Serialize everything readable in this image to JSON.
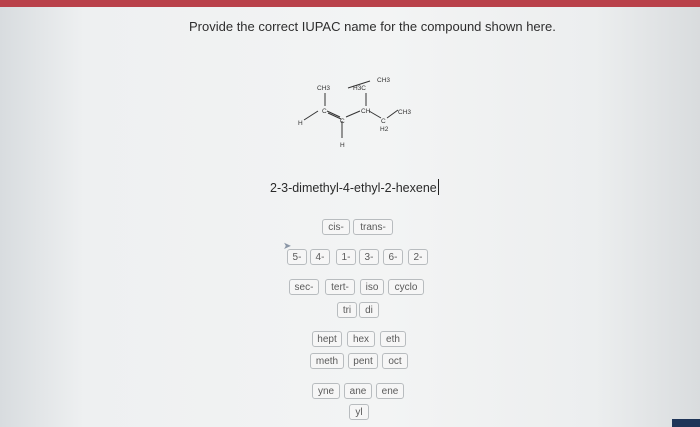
{
  "question": "Provide the correct IUPAC name for the compound shown here.",
  "answer_text": "2-3-dimethyl-4-ethyl-2-hexene",
  "structure": {
    "labels": [
      "CH3",
      "H3C",
      "CH3",
      "CH",
      "CH3",
      "C",
      "C",
      "H",
      "H",
      "C",
      "H2"
    ]
  },
  "stereo_tiles": [
    "cis-",
    "trans-"
  ],
  "locant_tiles": [
    "5-",
    "4-",
    "1-",
    "3-",
    "6-",
    "2-"
  ],
  "prefix_tiles": [
    "sec-",
    "tert-",
    "iso",
    "cyclo"
  ],
  "multiplier_tiles": [
    "tri",
    "di"
  ],
  "root_tiles_row1": [
    "hept",
    "hex",
    "eth"
  ],
  "root_tiles_row2": [
    "meth",
    "pent",
    "oct"
  ],
  "suffix_tiles": [
    "yne",
    "ane",
    "ene"
  ],
  "substituent_tiles": [
    "yl"
  ],
  "colors": {
    "top_bar": "#b9414a",
    "tile_border": "#b8bcbf"
  }
}
